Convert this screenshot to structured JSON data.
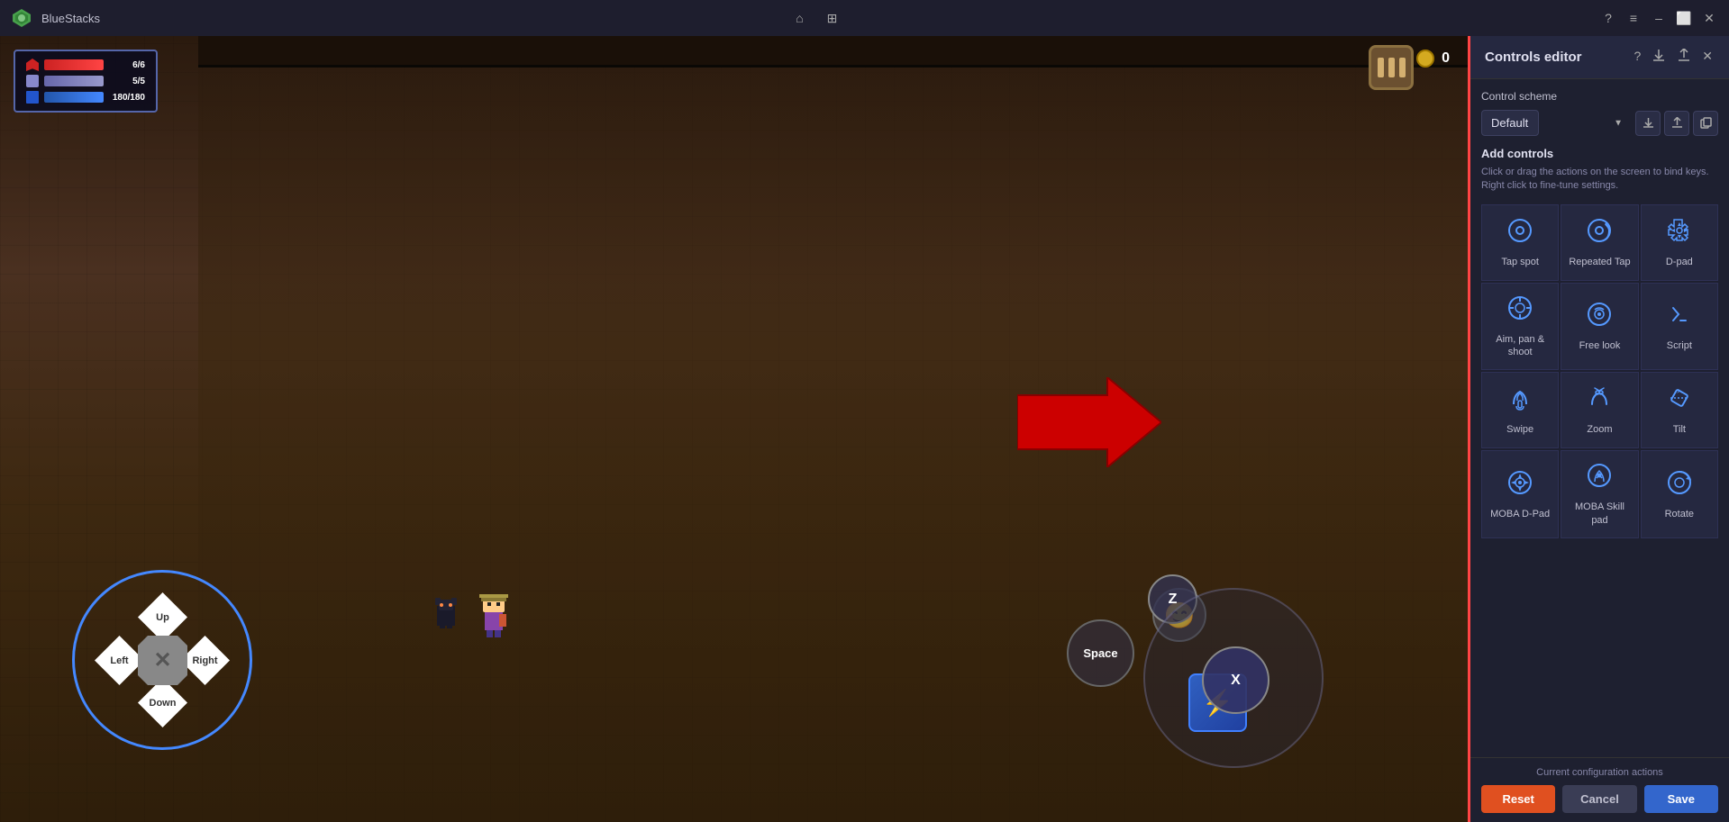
{
  "app": {
    "title": "BlueStacks",
    "logo_text": "🎮"
  },
  "titlebar": {
    "title": "BlueStacks",
    "help_label": "?",
    "menu_label": "≡",
    "minimize_label": "–",
    "maximize_label": "⬜",
    "close_label": "✕",
    "home_label": "⌂",
    "layout_label": "⊞"
  },
  "game": {
    "hud": {
      "hp_current": "6",
      "hp_max": "6",
      "hp_label": "6/6",
      "mp_current": "5",
      "mp_max": "5",
      "mp_label": "5/5",
      "stamina_current": "180",
      "stamina_max": "180",
      "stamina_label": "180/180",
      "coins": "0"
    },
    "controls": {
      "dpad": {
        "up": "Up",
        "down": "Down",
        "left": "Left",
        "right": "Right"
      },
      "buttons": {
        "z": "Z",
        "x": "X",
        "space": "Space"
      }
    }
  },
  "panel": {
    "title": "Controls editor",
    "scheme_label": "Control scheme",
    "scheme_value": "Default",
    "add_controls_title": "Add controls",
    "add_controls_desc": "Click or drag the actions on the screen to bind keys. Right click to fine-tune settings.",
    "controls": [
      {
        "id": "tap-spot",
        "label": "Tap spot",
        "icon": "tap"
      },
      {
        "id": "repeated-tap",
        "label": "Repeated Tap",
        "icon": "repeated-tap"
      },
      {
        "id": "d-pad",
        "label": "D-pad",
        "icon": "dpad"
      },
      {
        "id": "aim-pan-shoot",
        "label": "Aim, pan & shoot",
        "icon": "aim"
      },
      {
        "id": "free-look",
        "label": "Free look",
        "icon": "free-look"
      },
      {
        "id": "script",
        "label": "Script",
        "icon": "script"
      },
      {
        "id": "swipe",
        "label": "Swipe",
        "icon": "swipe"
      },
      {
        "id": "zoom",
        "label": "Zoom",
        "icon": "zoom"
      },
      {
        "id": "tilt",
        "label": "Tilt",
        "icon": "tilt"
      },
      {
        "id": "moba-dpad",
        "label": "MOBA D-Pad",
        "icon": "moba-dpad"
      },
      {
        "id": "moba-skill-pad",
        "label": "MOBA Skill pad",
        "icon": "moba-skill"
      },
      {
        "id": "rotate",
        "label": "Rotate",
        "icon": "rotate"
      }
    ],
    "footer": {
      "config_label": "Current configuration actions",
      "reset_label": "Reset",
      "cancel_label": "Cancel",
      "save_label": "Save"
    }
  }
}
